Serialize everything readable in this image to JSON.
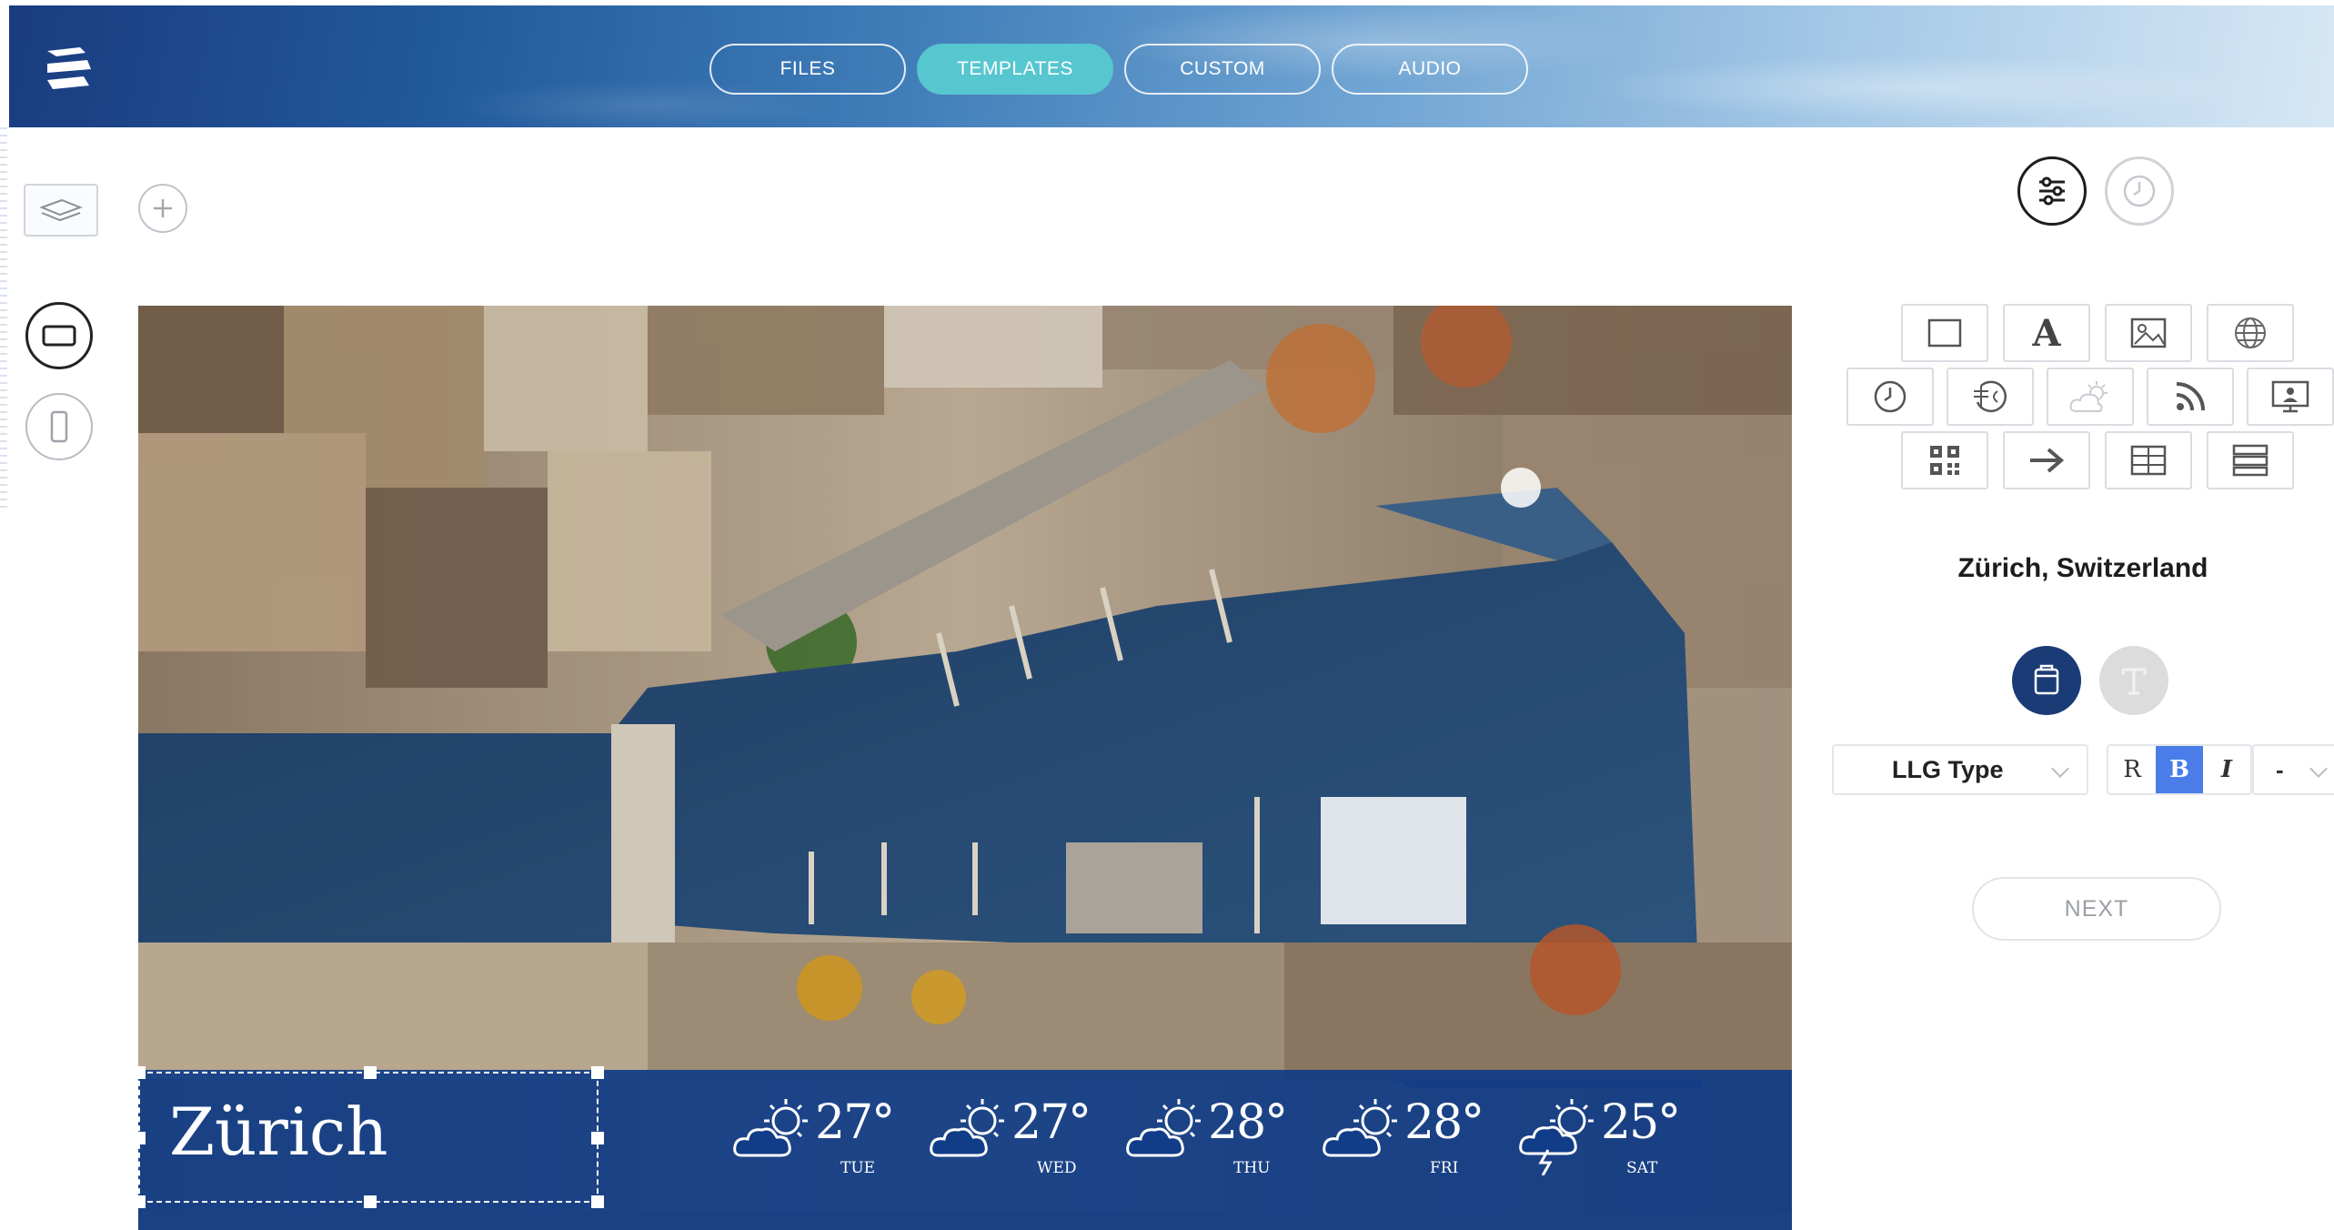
{
  "header": {
    "tabs": [
      {
        "label": "FILES",
        "active": false
      },
      {
        "label": "TEMPLATES",
        "active": true
      },
      {
        "label": "CUSTOM",
        "active": false
      },
      {
        "label": "AUDIO",
        "active": false
      }
    ]
  },
  "left_tools": {
    "icons": [
      "layers-icon",
      "plus-icon",
      "landscape-icon",
      "portrait-icon"
    ]
  },
  "canvas": {
    "city_label": "Zürich",
    "forecast": [
      {
        "temp": "27°",
        "day": "TUE",
        "icon": "partly-cloudy-icon"
      },
      {
        "temp": "27°",
        "day": "WED",
        "icon": "partly-cloudy-icon"
      },
      {
        "temp": "28°",
        "day": "THU",
        "icon": "partly-cloudy-icon"
      },
      {
        "temp": "28°",
        "day": "FRI",
        "icon": "partly-cloudy-icon"
      },
      {
        "temp": "25°",
        "day": "SAT",
        "icon": "thunderstorm-icon"
      }
    ],
    "bar_color": "#113c87"
  },
  "panel": {
    "tabs": [
      "settings-icon",
      "clock-icon"
    ],
    "widgets": {
      "row1": [
        "rectangle-icon",
        "text-icon",
        "image-icon",
        "globe-icon"
      ],
      "row2": [
        "clock-icon",
        "currency-icon",
        "weather-icon",
        "rss-icon",
        "presentation-icon"
      ],
      "row3": [
        "qr-code-icon",
        "arrow-right-icon",
        "table-icon",
        "rows-icon"
      ],
      "text_widget_glyph": "A"
    },
    "location": "Zürich, Switzerland",
    "font": "LLG Type",
    "format_buttons": [
      "R",
      "B",
      "I"
    ],
    "size_value": "-",
    "next_label": "NEXT",
    "accent": "#4a7de8",
    "style_bg_color": "#1a3b76"
  }
}
